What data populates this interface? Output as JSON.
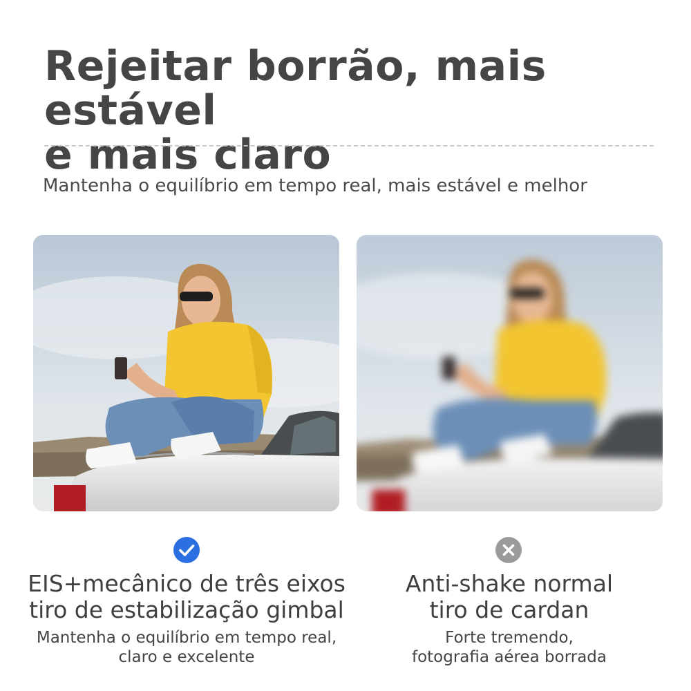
{
  "headline": {
    "line1": "Rejeitar borrão, mais estável",
    "line2": "e mais claro"
  },
  "subtitle": "Mantenha o equilíbrio em tempo real, mais estável e melhor",
  "comparison": [
    {
      "status": "check-icon",
      "status_color": "#2b6fe0",
      "title_line1": "EIS+mecânico de três eixos",
      "title_line2": "tiro de estabilização gimbal",
      "desc_line1": "Mantenha o equilíbrio em tempo real,",
      "desc_line2": "claro e excelente"
    },
    {
      "status": "cross-icon",
      "status_color": "#9a9a9a",
      "title_line1": "Anti-shake normal",
      "title_line2": "tiro de cardan",
      "desc_line1": "Forte tremendo,",
      "desc_line2": "fotografia aérea borrada"
    }
  ]
}
